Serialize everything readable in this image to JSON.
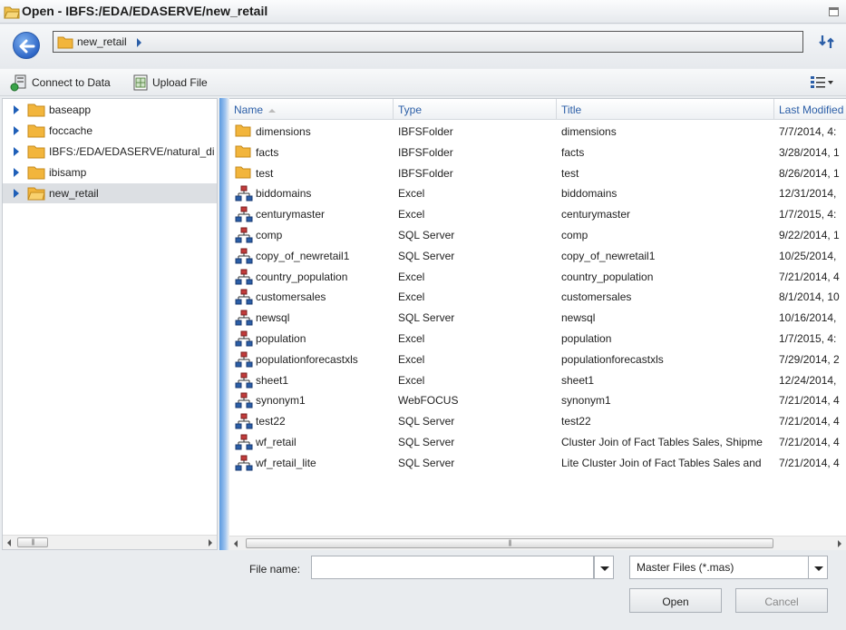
{
  "window": {
    "title": "Open - IBFS:/EDA/EDASERVE/new_retail"
  },
  "nav": {
    "breadcrumb": "new_retail"
  },
  "toolbar": {
    "connect_label": "Connect to Data",
    "upload_label": "Upload File"
  },
  "tree": {
    "items": [
      {
        "label": "baseapp",
        "selected": false
      },
      {
        "label": "foccache",
        "selected": false
      },
      {
        "label": "IBFS:/EDA/EDASERVE/natural_di",
        "selected": false
      },
      {
        "label": "ibisamp",
        "selected": false
      },
      {
        "label": "new_retail",
        "selected": true
      }
    ]
  },
  "list": {
    "columns": [
      "Name",
      "Type",
      "Title",
      "Last Modified"
    ],
    "rows": [
      {
        "name": "dimensions",
        "type": "IBFSFolder",
        "title": "dimensions",
        "modified": "7/7/2014, 4:",
        "icon": "folder-icon"
      },
      {
        "name": "facts",
        "type": "IBFSFolder",
        "title": "facts",
        "modified": "3/28/2014, 1",
        "icon": "folder-icon"
      },
      {
        "name": "test",
        "type": "IBFSFolder",
        "title": "test",
        "modified": "8/26/2014, 1",
        "icon": "folder-icon"
      },
      {
        "name": "biddomains",
        "type": "Excel",
        "title": "biddomains",
        "modified": "12/31/2014,",
        "icon": "synonym-icon"
      },
      {
        "name": "centurymaster",
        "type": "Excel",
        "title": "centurymaster",
        "modified": "1/7/2015, 4:",
        "icon": "synonym-icon"
      },
      {
        "name": "comp",
        "type": "SQL Server",
        "title": "comp",
        "modified": "9/22/2014, 1",
        "icon": "synonym-icon"
      },
      {
        "name": "copy_of_newretail1",
        "type": "SQL Server",
        "title": "copy_of_newretail1",
        "modified": "10/25/2014,",
        "icon": "synonym-icon"
      },
      {
        "name": "country_population",
        "type": "Excel",
        "title": "country_population",
        "modified": "7/21/2014, 4",
        "icon": "synonym-icon"
      },
      {
        "name": "customersales",
        "type": "Excel",
        "title": "customersales",
        "modified": "8/1/2014, 10",
        "icon": "synonym-icon"
      },
      {
        "name": "newsql",
        "type": "SQL Server",
        "title": "newsql",
        "modified": "10/16/2014,",
        "icon": "synonym-icon"
      },
      {
        "name": "population",
        "type": "Excel",
        "title": "population",
        "modified": "1/7/2015, 4:",
        "icon": "synonym-icon"
      },
      {
        "name": "populationforecastxls",
        "type": "Excel",
        "title": "populationforecastxls",
        "modified": "7/29/2014, 2",
        "icon": "synonym-icon"
      },
      {
        "name": "sheet1",
        "type": "Excel",
        "title": "sheet1",
        "modified": "12/24/2014,",
        "icon": "synonym-icon"
      },
      {
        "name": "synonym1",
        "type": "WebFOCUS",
        "title": "synonym1",
        "modified": "7/21/2014, 4",
        "icon": "synonym-icon"
      },
      {
        "name": "test22",
        "type": "SQL Server",
        "title": "test22",
        "modified": "7/21/2014, 4",
        "icon": "synonym-icon"
      },
      {
        "name": "wf_retail",
        "type": "SQL Server",
        "title": "Cluster Join of Fact Tables Sales, Shipme",
        "modified": "7/21/2014, 4",
        "icon": "synonym-icon"
      },
      {
        "name": "wf_retail_lite",
        "type": "SQL Server",
        "title": "Lite Cluster Join of Fact Tables Sales and",
        "modified": "7/21/2014, 4",
        "icon": "synonym-icon"
      }
    ]
  },
  "footer": {
    "file_name_label": "File name:",
    "file_name_value": "",
    "filter_value": "Master Files (*.mas)",
    "open_label": "Open",
    "cancel_label": "Cancel"
  },
  "colors": {
    "accent": "#2b5ea7",
    "splitter": "#5c9ae0",
    "folder": "#f2b53c"
  }
}
